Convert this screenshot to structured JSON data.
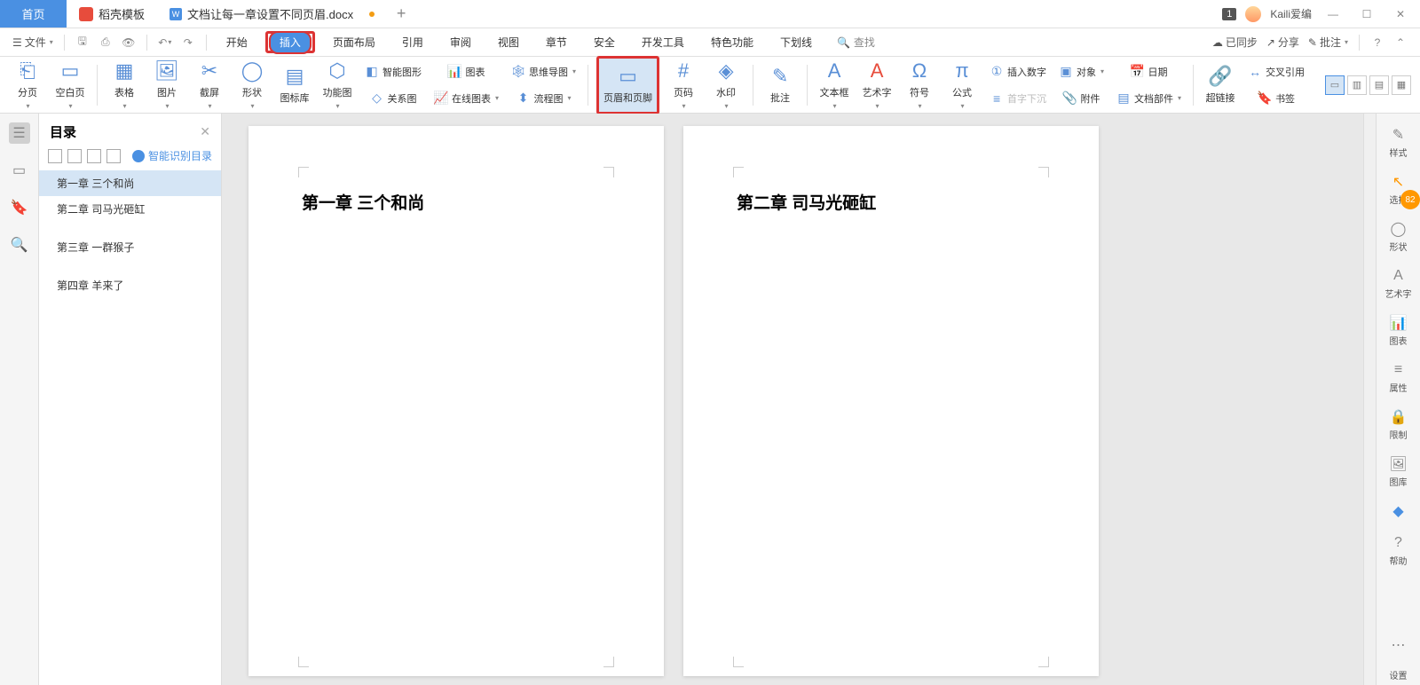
{
  "titlebar": {
    "home": "首页",
    "docer": "稻壳模板",
    "doc_name": "文档让每一章设置不同页眉.docx",
    "user_name": "Kaili爱编",
    "badge": "1"
  },
  "quickbar": {
    "file_menu": "文件",
    "menus": [
      "开始",
      "插入",
      "页面布局",
      "引用",
      "审阅",
      "视图",
      "章节",
      "安全",
      "开发工具",
      "特色功能",
      "下划线"
    ],
    "active_menu_index": 1,
    "search_placeholder": "查找",
    "sync": "已同步",
    "share": "分享",
    "approve": "批注"
  },
  "ribbon": {
    "page_break": "分页",
    "blank_page": "空白页",
    "table": "表格",
    "picture": "图片",
    "screenshot": "截屏",
    "shapes": "形状",
    "icon_lib": "图标库",
    "smart_diagram": "功能图",
    "smart_shape": "智能图形",
    "relation": "关系图",
    "chart": "图表",
    "online_chart": "在线图表",
    "mindmap": "思维导图",
    "flowchart": "流程图",
    "header_footer": "页眉和页脚",
    "page_number": "页码",
    "watermark": "水印",
    "comment": "批注",
    "textbox": "文本框",
    "wordart": "艺术字",
    "symbol": "符号",
    "equation": "公式",
    "insert_number": "插入数字",
    "object": "对象",
    "dropcap": "首字下沉",
    "date": "日期",
    "attachment": "附件",
    "doc_parts": "文档部件",
    "hyperlink": "超链接",
    "cross_ref": "交叉引用",
    "bookmark": "书签"
  },
  "outline": {
    "title": "目录",
    "smart_toc": "智能识别目录",
    "items": [
      "第一章  三个和尚",
      "第二章  司马光砸缸",
      "第三章  一群猴子",
      "第四章  羊来了"
    ],
    "selected_index": 0
  },
  "pages": {
    "page1_heading": "第一章  三个和尚",
    "page2_heading": "第二章  司马光砸缸"
  },
  "right_rail": {
    "style": "样式",
    "select": "选择",
    "shape": "形状",
    "wordart": "艺术字",
    "chart": "图表",
    "property": "属性",
    "restrict": "限制",
    "gallery": "图库",
    "help": "帮助",
    "settings": "设置",
    "badge": "82"
  }
}
